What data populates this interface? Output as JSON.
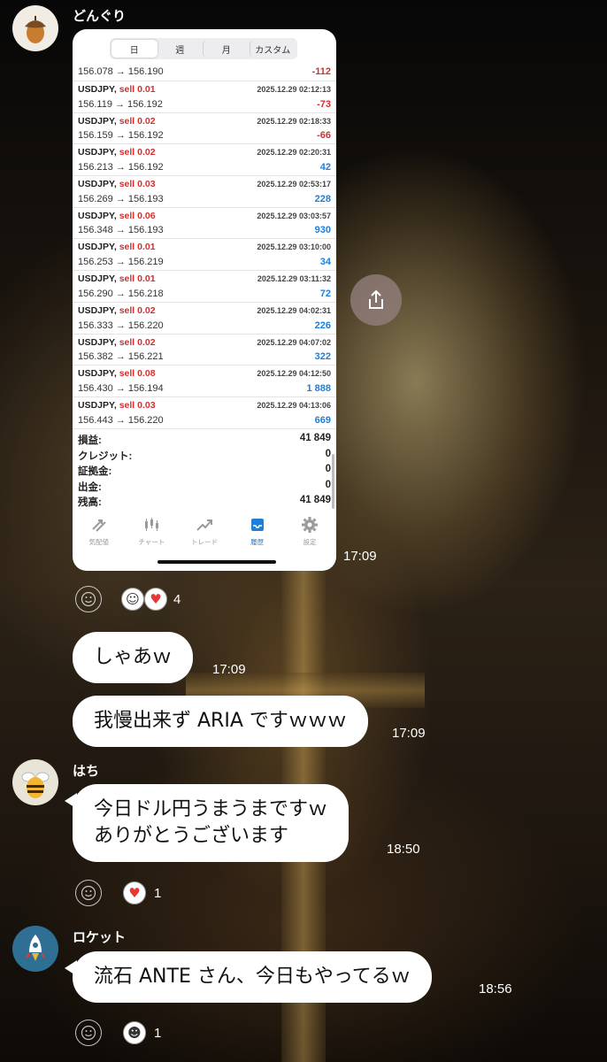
{
  "messages": [
    {
      "sender": "どんぐり",
      "time": "17:09",
      "reaction_count": "4"
    },
    {
      "text": "しゃあｗ",
      "time": "17:09"
    },
    {
      "text": "我慢出来ず ARIA ですｗｗｗ",
      "time": "17:09"
    },
    {
      "sender": "はち",
      "line1": "今日ドル円うまうまですｗ",
      "line2": "ありがとうございます",
      "time": "18:50",
      "reaction_count": "1"
    },
    {
      "sender": "ロケット",
      "text": "流石 ANTE さん、今日もやってるｗ",
      "time": "18:56",
      "reaction_count": "1"
    }
  ],
  "trade_screenshot": {
    "tabs": [
      "日",
      "週",
      "月",
      "カスタム"
    ],
    "active_tab": "日",
    "first_row": {
      "price": "156.078 → 156.190",
      "pl": "-112"
    },
    "trades": [
      {
        "symbol": "USDJPY,",
        "side": "sell 0.01",
        "date": "2025.12.29 02:12:13",
        "price": "156.119 → 156.192",
        "pl": "-73",
        "neg": true
      },
      {
        "symbol": "USDJPY,",
        "side": "sell 0.02",
        "date": "2025.12.29 02:18:33",
        "price": "156.159 → 156.192",
        "pl": "-66",
        "neg": true
      },
      {
        "symbol": "USDJPY,",
        "side": "sell 0.02",
        "date": "2025.12.29 02:20:31",
        "price": "156.213 → 156.192",
        "pl": "42",
        "neg": false
      },
      {
        "symbol": "USDJPY,",
        "side": "sell 0.03",
        "date": "2025.12.29 02:53:17",
        "price": "156.269 → 156.193",
        "pl": "228",
        "neg": false
      },
      {
        "symbol": "USDJPY,",
        "side": "sell 0.06",
        "date": "2025.12.29 03:03:57",
        "price": "156.348 → 156.193",
        "pl": "930",
        "neg": false
      },
      {
        "symbol": "USDJPY,",
        "side": "sell 0.01",
        "date": "2025.12.29 03:10:00",
        "price": "156.253 → 156.219",
        "pl": "34",
        "neg": false
      },
      {
        "symbol": "USDJPY,",
        "side": "sell 0.01",
        "date": "2025.12.29 03:11:32",
        "price": "156.290 → 156.218",
        "pl": "72",
        "neg": false
      },
      {
        "symbol": "USDJPY,",
        "side": "sell 0.02",
        "date": "2025.12.29 04:02:31",
        "price": "156.333 → 156.220",
        "pl": "226",
        "neg": false
      },
      {
        "symbol": "USDJPY,",
        "side": "sell 0.02",
        "date": "2025.12.29 04:07:02",
        "price": "156.382 → 156.221",
        "pl": "322",
        "neg": false
      },
      {
        "symbol": "USDJPY,",
        "side": "sell 0.08",
        "date": "2025.12.29 04:12:50",
        "price": "156.430 → 156.194",
        "pl": "1 888",
        "neg": false
      },
      {
        "symbol": "USDJPY,",
        "side": "sell 0.03",
        "date": "2025.12.29 04:13:06",
        "price": "156.443 → 156.220",
        "pl": "669",
        "neg": false
      }
    ],
    "summary": [
      {
        "label": "損益:",
        "value": "41 849"
      },
      {
        "label": "クレジット:",
        "value": "0"
      },
      {
        "label": "証拠金:",
        "value": "0"
      },
      {
        "label": "出金:",
        "value": "0"
      },
      {
        "label": "残高:",
        "value": "41 849"
      }
    ],
    "bottom_tabs": [
      {
        "label": "気配値",
        "icon": "arrows-icon"
      },
      {
        "label": "チャート",
        "icon": "candles-icon"
      },
      {
        "label": "トレード",
        "icon": "trend-icon"
      },
      {
        "label": "履歴",
        "icon": "inbox-icon",
        "active": true
      },
      {
        "label": "設定",
        "icon": "gear-icon"
      }
    ]
  },
  "colors": {
    "negative": "#d32f2f",
    "positive": "#1e7fd8",
    "bubble": "#ffffff"
  }
}
